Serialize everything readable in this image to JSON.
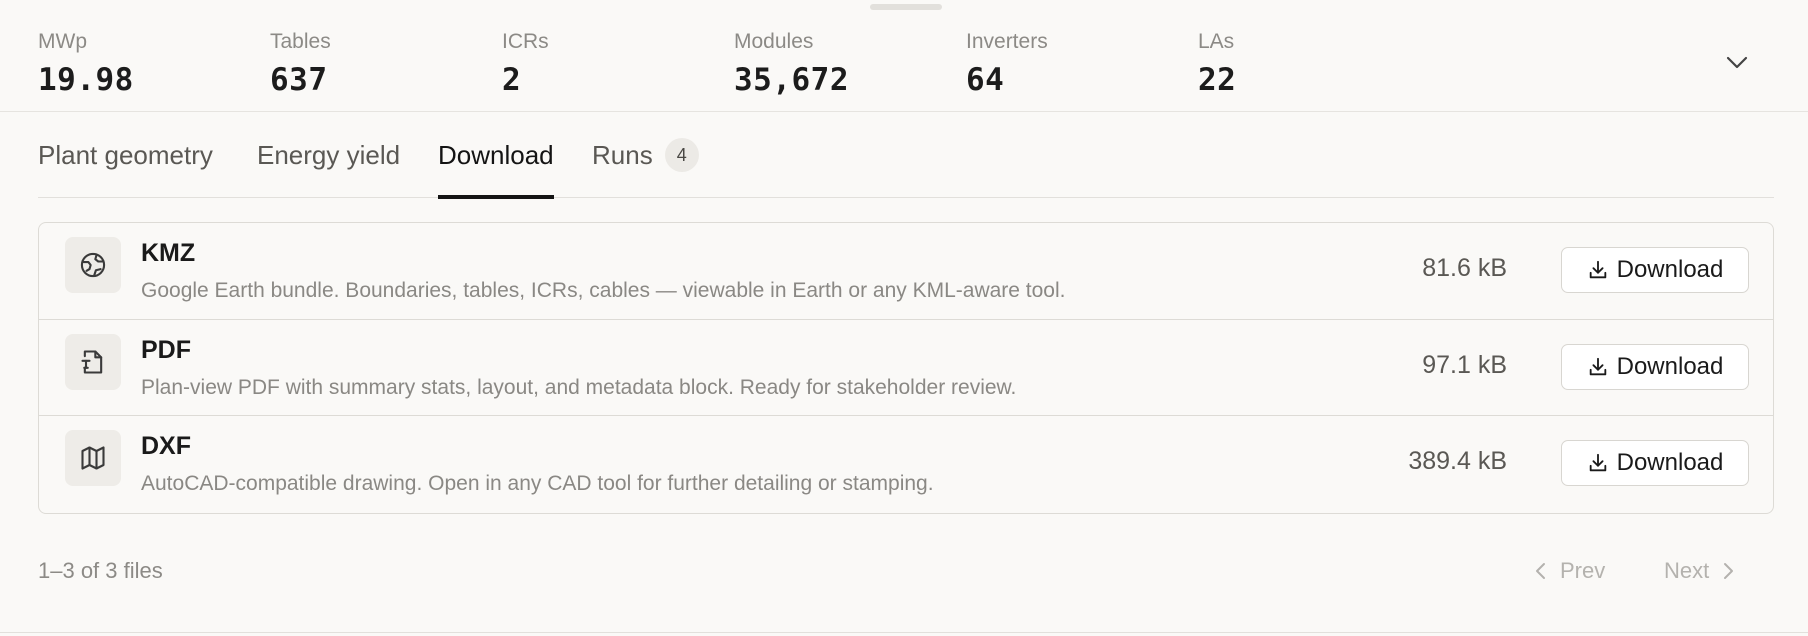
{
  "stats": [
    {
      "label": "MWp",
      "value": "19.98"
    },
    {
      "label": "Tables",
      "value": "637"
    },
    {
      "label": "ICRs",
      "value": "2"
    },
    {
      "label": "Modules",
      "value": "35,672"
    },
    {
      "label": "Inverters",
      "value": "64"
    },
    {
      "label": "LAs",
      "value": "22"
    }
  ],
  "tabs": [
    {
      "label": "Plant geometry",
      "active": false
    },
    {
      "label": "Energy yield",
      "active": false
    },
    {
      "label": "Download",
      "active": true
    },
    {
      "label": "Runs",
      "badge": "4",
      "active": false
    }
  ],
  "files": [
    {
      "name": "KMZ",
      "icon": "globe-icon",
      "description": "Google Earth bundle. Boundaries, tables, ICRs, cables — viewable in Earth or any KML-aware tool.",
      "size": "81.6 kB",
      "button_label": "Download"
    },
    {
      "name": "PDF",
      "icon": "file-text-icon",
      "description": "Plan-view PDF with summary stats, layout, and metadata block. Ready for stakeholder review.",
      "size": "97.1 kB",
      "button_label": "Download"
    },
    {
      "name": "DXF",
      "icon": "map-icon",
      "description": "AutoCAD-compatible drawing. Open in any CAD tool for further detailing or stamping.",
      "size": "389.4 kB",
      "button_label": "Download"
    }
  ],
  "footer": {
    "count_text": "1–3 of 3 files",
    "prev_label": "Prev",
    "next_label": "Next"
  },
  "colors": {
    "background": "#faf9f7",
    "text_primary": "#1a1a1a",
    "text_muted": "#8a8884",
    "border": "#dddbd6",
    "pager_disabled": "#b4b2ae"
  }
}
